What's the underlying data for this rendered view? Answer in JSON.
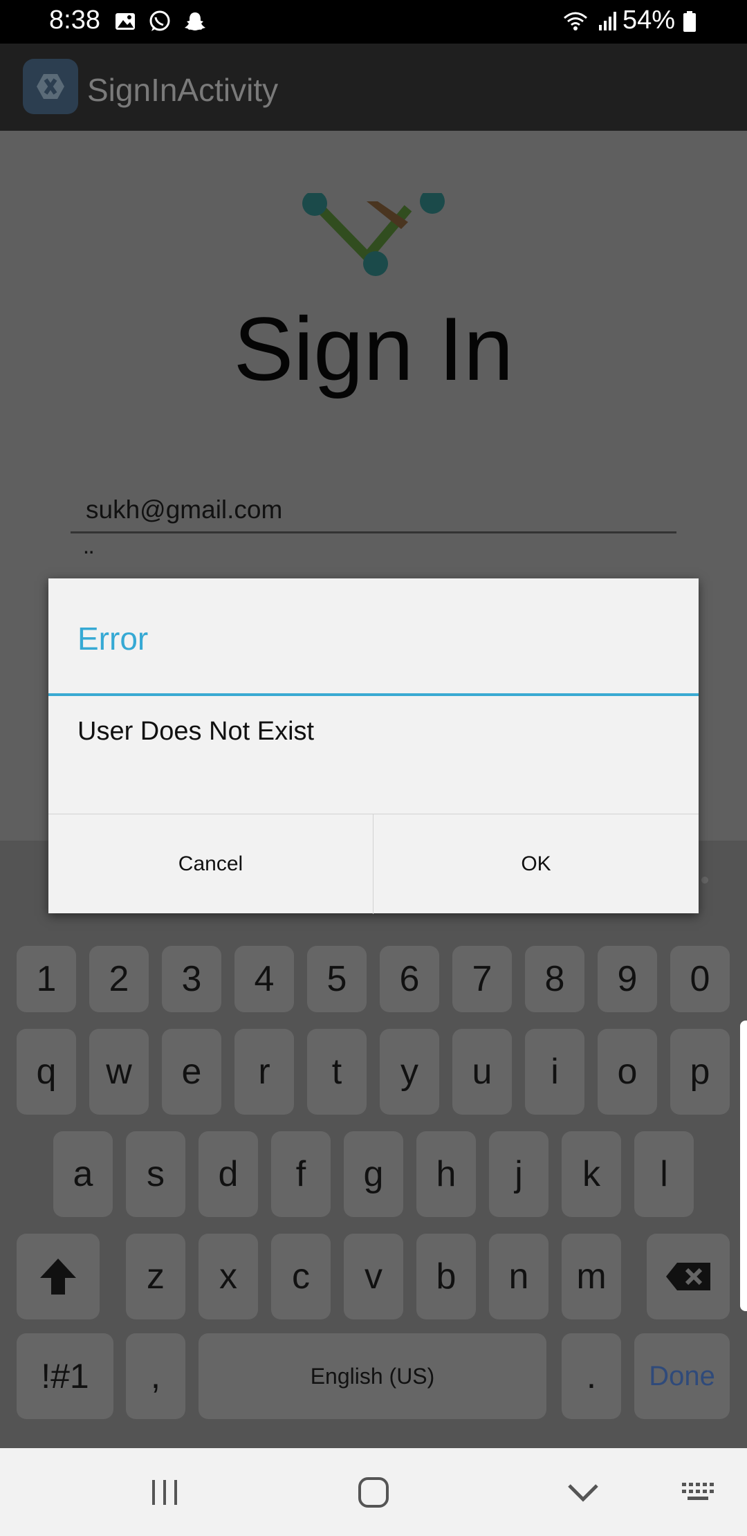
{
  "status_bar": {
    "time": "8:38",
    "battery": "54%",
    "left_icons": [
      "image-icon",
      "whatsapp-icon",
      "snapchat-icon"
    ],
    "right_icons": [
      "wifi-icon",
      "signal-icon",
      "battery-icon"
    ]
  },
  "app_bar": {
    "title": "SignInActivity",
    "logo_icon": "xamarin-logo-icon"
  },
  "main": {
    "logo_icon": "network-v-logo-icon",
    "title": "Sign In",
    "email_value": "sukh@gmail.com",
    "password_mask": "¨"
  },
  "dialog": {
    "title": "Error",
    "message": "User Does Not Exist",
    "cancel_label": "Cancel",
    "ok_label": "OK",
    "accent_color": "#36a9d4"
  },
  "keyboard": {
    "row_numbers": [
      "1",
      "2",
      "3",
      "4",
      "5",
      "6",
      "7",
      "8",
      "9",
      "0"
    ],
    "row_q": [
      "q",
      "w",
      "e",
      "r",
      "t",
      "y",
      "u",
      "i",
      "o",
      "p"
    ],
    "row_a": [
      "a",
      "s",
      "d",
      "f",
      "g",
      "h",
      "j",
      "k",
      "l"
    ],
    "row_z": [
      "z",
      "x",
      "c",
      "v",
      "b",
      "n",
      "m"
    ],
    "symbols_label": "!#1",
    "comma_label": ",",
    "space_label": "English (US)",
    "period_label": ".",
    "done_label": "Done",
    "shift_icon": "shift-up-arrow-icon",
    "backspace_icon": "backspace-icon"
  },
  "nav_bar": {
    "icons": [
      "recent-apps-icon",
      "home-icon",
      "back-chevron-icon",
      "keyboard-icon"
    ]
  }
}
